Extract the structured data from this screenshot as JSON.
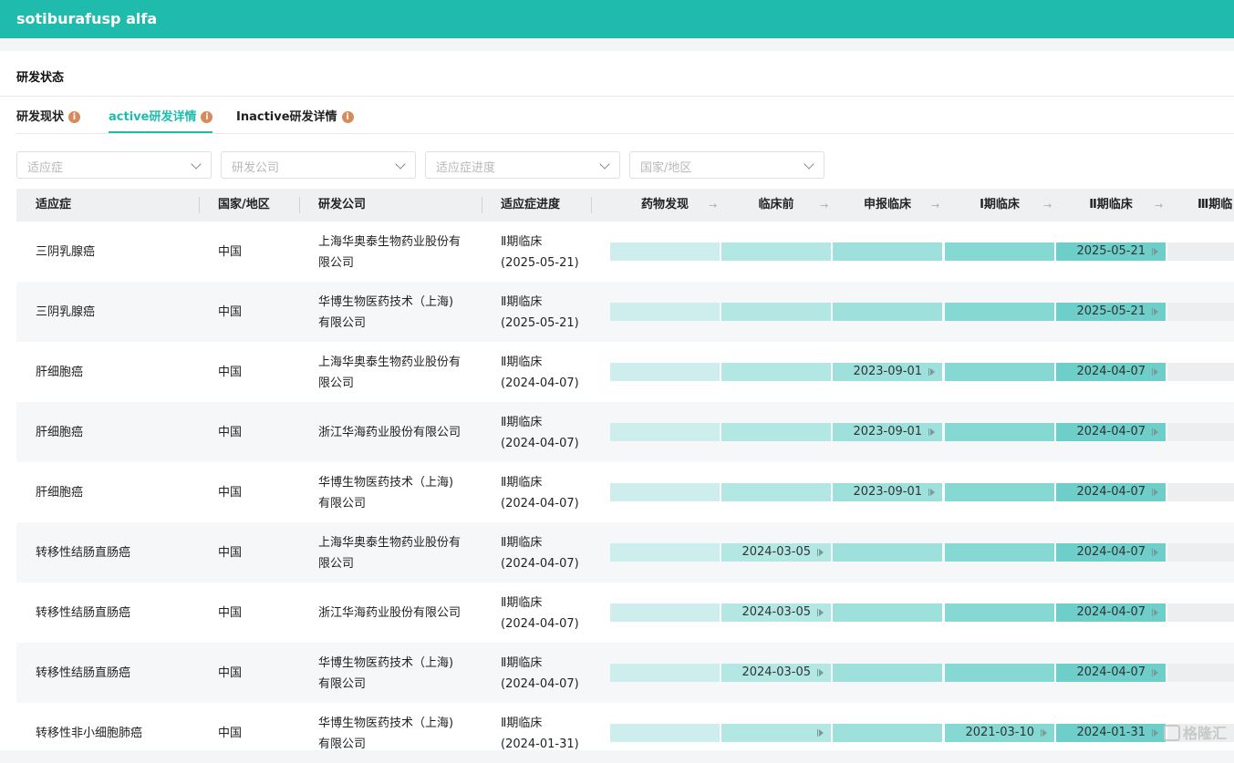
{
  "app": {
    "title": "sotiburafusp alfa"
  },
  "section": {
    "title": "研发状态"
  },
  "tabs": [
    {
      "label": "研发现状",
      "active": false
    },
    {
      "label": "active研发详情",
      "active": true
    },
    {
      "label": "Inactive研发详情",
      "active": false
    }
  ],
  "filters": [
    {
      "placeholder": "适应症"
    },
    {
      "placeholder": "研发公司"
    },
    {
      "placeholder": "适应症进度"
    },
    {
      "placeholder": "国家/地区"
    }
  ],
  "table": {
    "columns": [
      "适应症",
      "国家/地区",
      "研发公司",
      "适应症进度"
    ],
    "stages": [
      "药物发现",
      "临床前",
      "申报临床",
      "Ⅰ期临床",
      "Ⅱ期临床",
      "Ⅲ期临"
    ],
    "rows": [
      {
        "indication": "三阴乳腺癌",
        "country": "中国",
        "company_l1": "上海华奥泰生物药业股份有",
        "company_l2": "限公司",
        "progress_l1": "Ⅱ期临床",
        "progress_l2": "(2025-05-21)",
        "stage_dates": [
          "",
          "",
          "",
          "",
          "2025-05-21"
        ],
        "stage_markers": [
          false,
          false,
          false,
          false,
          true
        ]
      },
      {
        "indication": "三阴乳腺癌",
        "country": "中国",
        "company_l1": "华博生物医药技术（上海)",
        "company_l2": "有限公司",
        "progress_l1": "Ⅱ期临床",
        "progress_l2": "(2025-05-21)",
        "stage_dates": [
          "",
          "",
          "",
          "",
          "2025-05-21"
        ],
        "stage_markers": [
          false,
          false,
          false,
          false,
          true
        ]
      },
      {
        "indication": "肝细胞癌",
        "country": "中国",
        "company_l1": "上海华奥泰生物药业股份有",
        "company_l2": "限公司",
        "progress_l1": "Ⅱ期临床",
        "progress_l2": "(2024-04-07)",
        "stage_dates": [
          "",
          "",
          "2023-09-01",
          "",
          "2024-04-07"
        ],
        "stage_markers": [
          false,
          false,
          true,
          false,
          true
        ]
      },
      {
        "indication": "肝细胞癌",
        "country": "中国",
        "company_l1": "浙江华海药业股份有限公司",
        "company_l2": "",
        "progress_l1": "Ⅱ期临床",
        "progress_l2": "(2024-04-07)",
        "stage_dates": [
          "",
          "",
          "2023-09-01",
          "",
          "2024-04-07"
        ],
        "stage_markers": [
          false,
          false,
          true,
          false,
          true
        ]
      },
      {
        "indication": "肝细胞癌",
        "country": "中国",
        "company_l1": "华博生物医药技术（上海)",
        "company_l2": "有限公司",
        "progress_l1": "Ⅱ期临床",
        "progress_l2": "(2024-04-07)",
        "stage_dates": [
          "",
          "",
          "2023-09-01",
          "",
          "2024-04-07"
        ],
        "stage_markers": [
          false,
          false,
          true,
          false,
          true
        ]
      },
      {
        "indication": "转移性结肠直肠癌",
        "country": "中国",
        "company_l1": "上海华奥泰生物药业股份有",
        "company_l2": "限公司",
        "progress_l1": "Ⅱ期临床",
        "progress_l2": "(2024-04-07)",
        "stage_dates": [
          "",
          "2024-03-05",
          "",
          "",
          "2024-04-07"
        ],
        "stage_markers": [
          false,
          true,
          false,
          false,
          true
        ]
      },
      {
        "indication": "转移性结肠直肠癌",
        "country": "中国",
        "company_l1": "浙江华海药业股份有限公司",
        "company_l2": "",
        "progress_l1": "Ⅱ期临床",
        "progress_l2": "(2024-04-07)",
        "stage_dates": [
          "",
          "2024-03-05",
          "",
          "",
          "2024-04-07"
        ],
        "stage_markers": [
          false,
          true,
          false,
          false,
          true
        ]
      },
      {
        "indication": "转移性结肠直肠癌",
        "country": "中国",
        "company_l1": "华博生物医药技术（上海)",
        "company_l2": "有限公司",
        "progress_l1": "Ⅱ期临床",
        "progress_l2": "(2024-04-07)",
        "stage_dates": [
          "",
          "2024-03-05",
          "",
          "",
          "2024-04-07"
        ],
        "stage_markers": [
          false,
          true,
          false,
          false,
          true
        ]
      },
      {
        "indication": "转移性非小细胞肺癌",
        "country": "中国",
        "company_l1": "华博生物医药技术（上海)",
        "company_l2": "有限公司",
        "progress_l1": "Ⅱ期临床",
        "progress_l2": "(2024-01-31)",
        "stage_dates": [
          "",
          "",
          "",
          "2021-03-10",
          "2024-01-31"
        ],
        "stage_markers": [
          false,
          true,
          false,
          true,
          true
        ]
      }
    ]
  },
  "watermark": {
    "text": "格隆汇"
  }
}
